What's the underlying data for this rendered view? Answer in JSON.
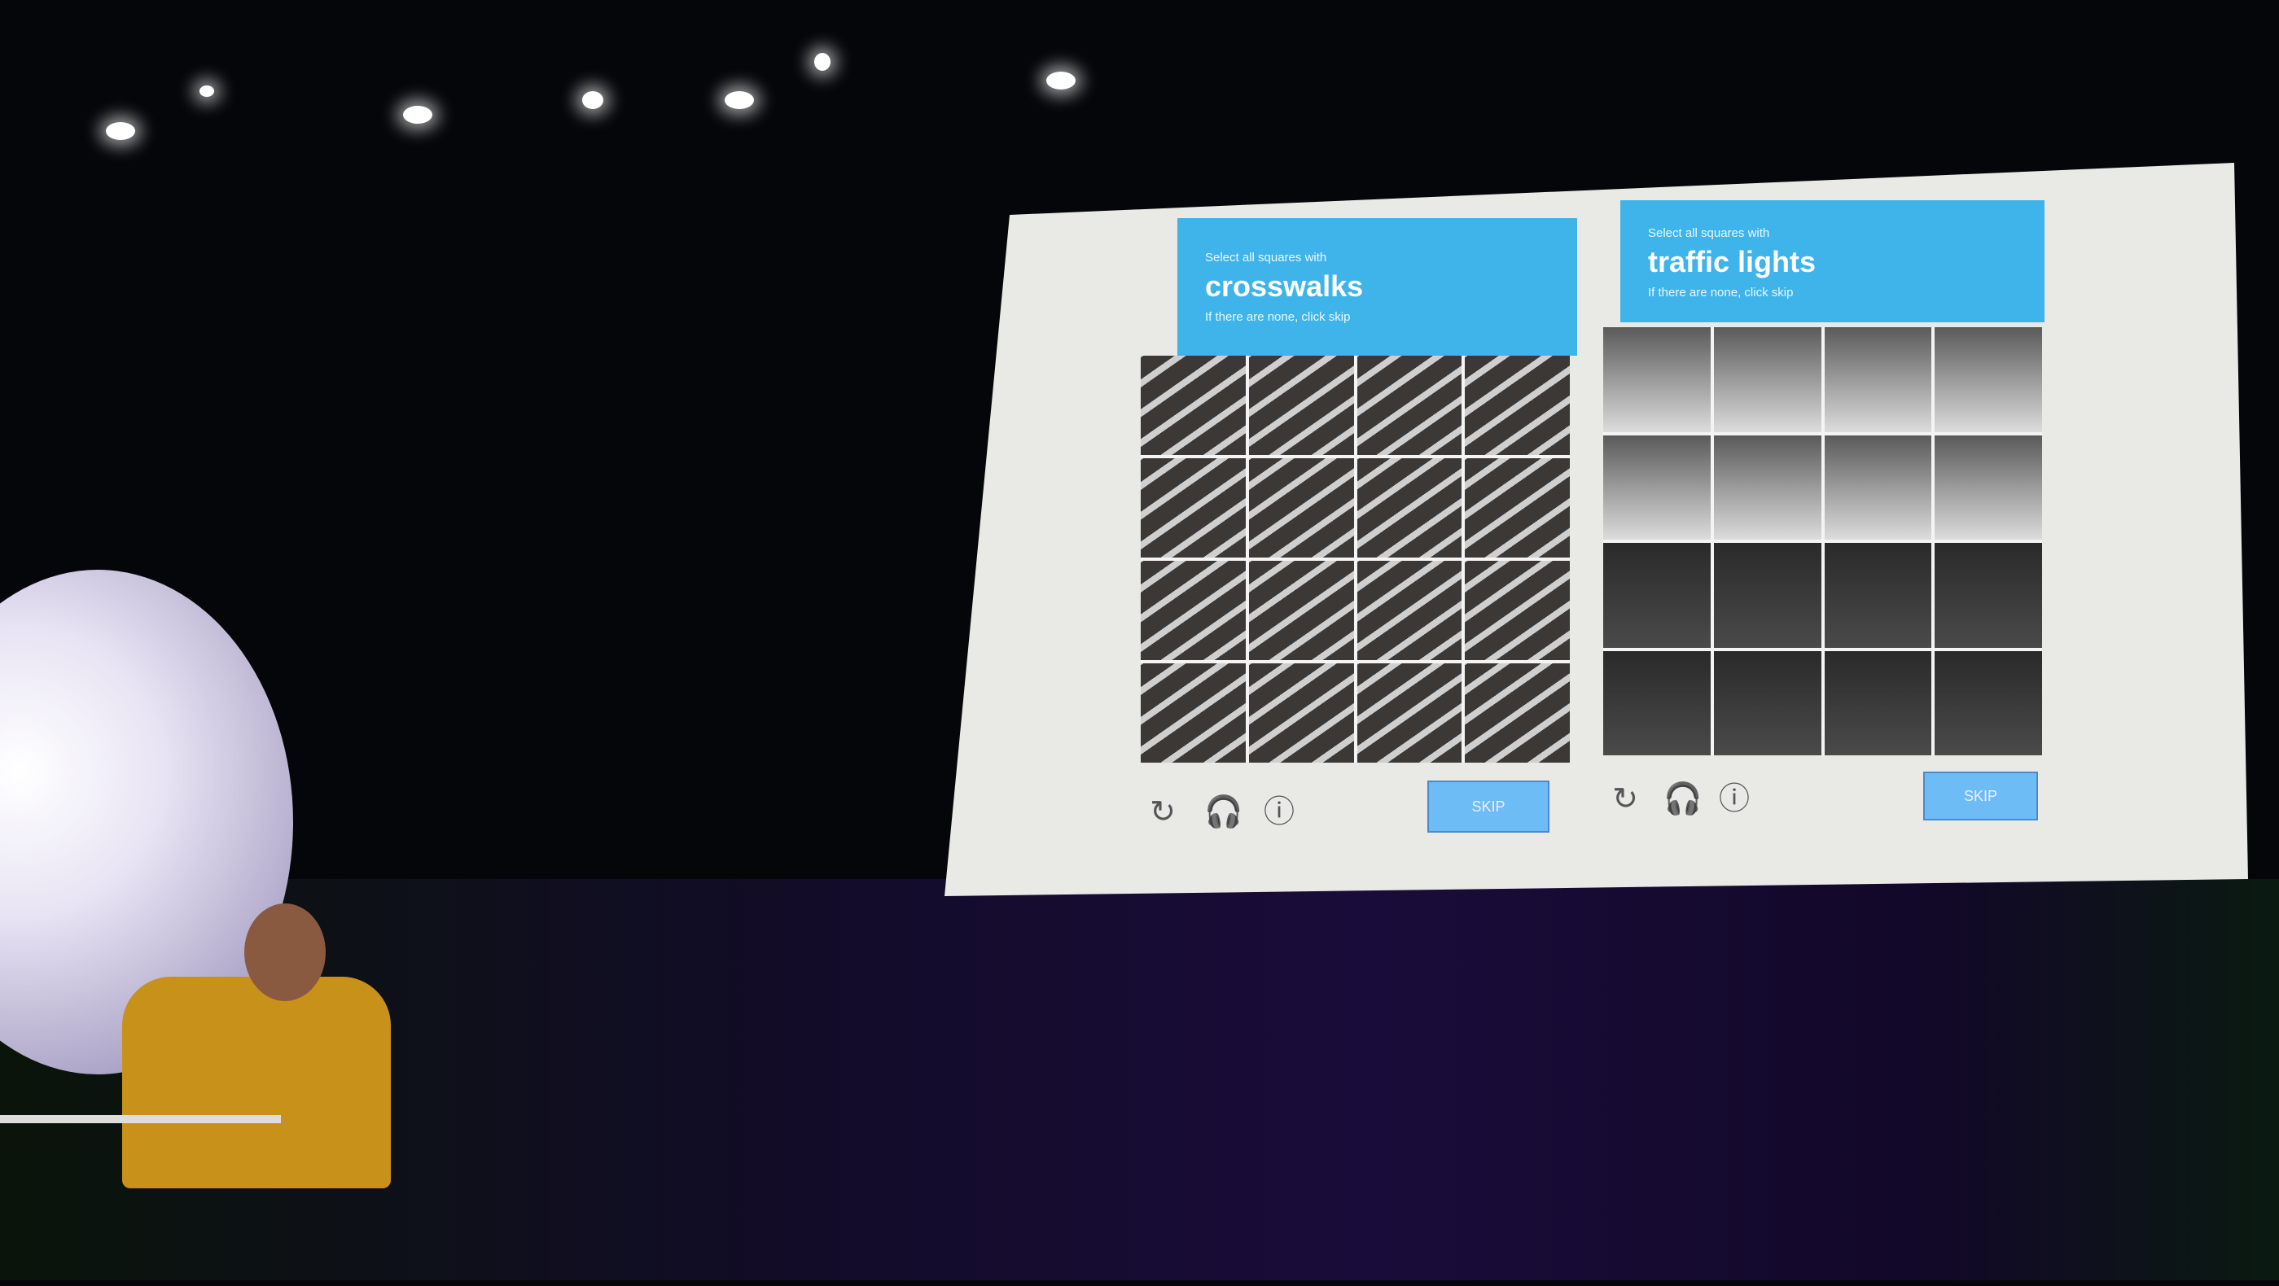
{
  "captchas": [
    {
      "prompt": "Select all squares with",
      "target": "crosswalks",
      "hint": "If there are none, click skip",
      "skip_label": "SKIP",
      "icons": [
        "reload-icon",
        "headphones-icon",
        "info-icon"
      ]
    },
    {
      "prompt": "Select all squares with",
      "target": "traffic lights",
      "hint": "If there are none, click skip",
      "skip_label": "SKIP",
      "icons": [
        "reload-icon",
        "headphones-icon",
        "info-icon"
      ]
    }
  ],
  "colors": {
    "header": "#3fb4ea",
    "skip_button": "#6ebcf5",
    "screen": "#e9e9e6"
  }
}
